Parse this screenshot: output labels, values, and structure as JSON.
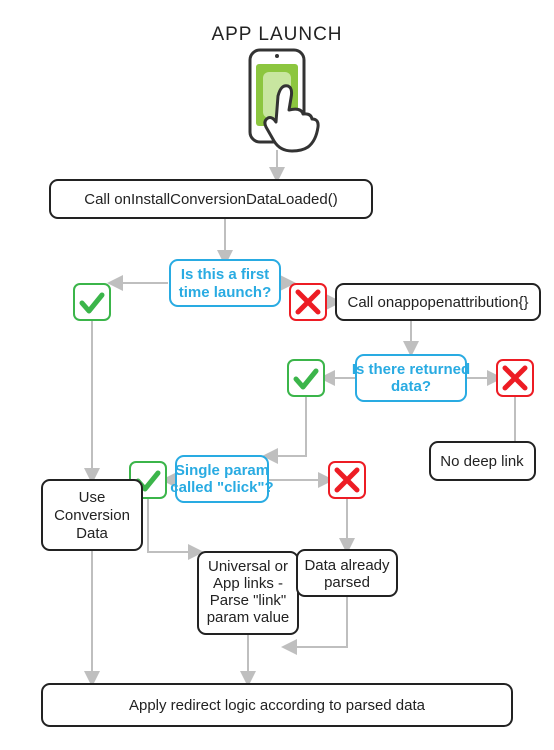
{
  "title": "APP LAUNCH",
  "nodes": {
    "call_onInstall": "Call onInstallConversionDataLoaded()",
    "q_firstLaunch_l1": "Is this a first",
    "q_firstLaunch_l2": "time launch?",
    "call_onAppOpen": "Call onappopenattribution{}",
    "q_returnedData_l1": "Is there returned",
    "q_returnedData_l2": "data?",
    "useConvData_l1": "Use",
    "useConvData_l2": "Conversion",
    "useConvData_l3": "Data",
    "noDeepLink": "No deep link",
    "q_singleParam_l1": "Single param",
    "q_singleParam_l2": "called \"click\"?",
    "universal_l1": "Universal or",
    "universal_l2": "App links -",
    "universal_l3": "Parse \"link\"",
    "universal_l4": "param value",
    "dataParsed_l1": "Data already",
    "dataParsed_l2": "parsed",
    "applyRedirect": "Apply redirect logic according to parsed data"
  },
  "icons": {
    "yes": "check-icon",
    "no": "cross-icon"
  },
  "colors": {
    "blue": "#29abe2",
    "green": "#3bb54a",
    "red": "#ed1c24",
    "black": "#222222",
    "edge": "#bfbfbf",
    "phoneAccent": "#8cc63f"
  }
}
